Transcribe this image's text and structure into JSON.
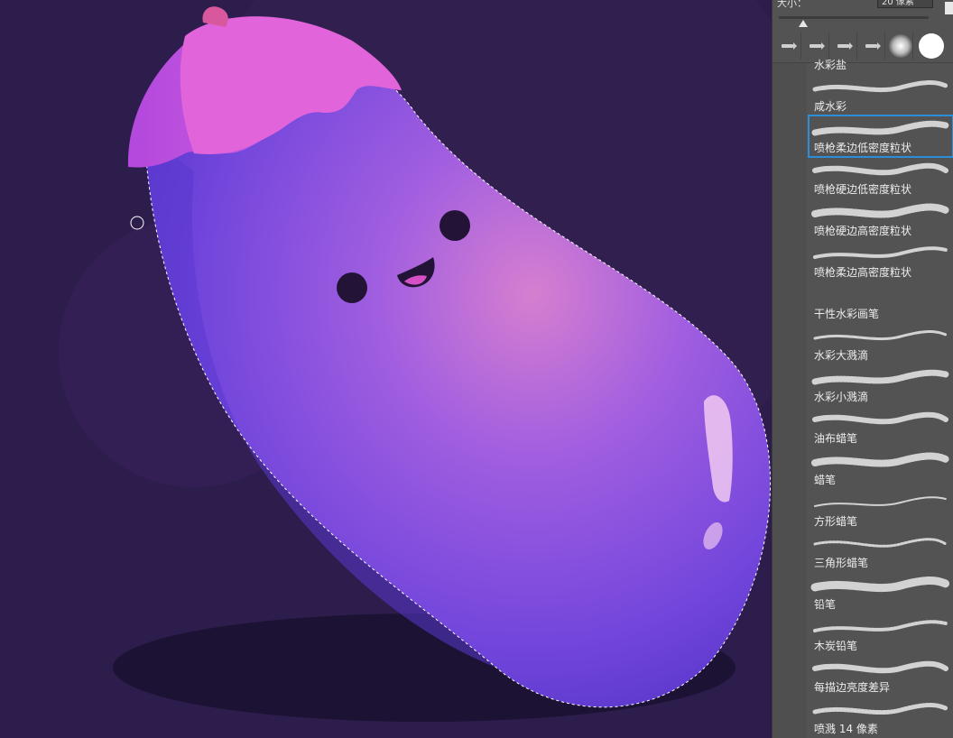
{
  "brush_panel": {
    "size_label": "大小：",
    "size_value": "20 像素",
    "brush_presets": [
      {
        "label": "水彩盐",
        "stroke": "none"
      },
      {
        "label": "咸水彩",
        "stroke": "watercolor-salt-icon"
      },
      {
        "label": "喷枪柔边低密度粒状",
        "stroke": "spray-soft-low-icon",
        "selected": true
      },
      {
        "label": "喷枪硬边低密度粒状",
        "stroke": "spray-hard-low-icon"
      },
      {
        "label": "喷枪硬边高密度粒状",
        "stroke": "spray-hard-high-icon"
      },
      {
        "label": "喷枪柔边高密度粒状",
        "stroke": "spray-soft-high-icon"
      },
      {
        "label": "干性水彩画笔",
        "stroke": "none"
      },
      {
        "label": "水彩大溅滴",
        "stroke": "splatter-large-icon"
      },
      {
        "label": "水彩小溅滴",
        "stroke": "splatter-small-icon"
      },
      {
        "label": "油布蜡笔",
        "stroke": "oil-crayon-icon"
      },
      {
        "label": "蜡笔",
        "stroke": "crayon-icon"
      },
      {
        "label": "方形蜡笔",
        "stroke": "square-crayon-icon"
      },
      {
        "label": "三角形蜡笔",
        "stroke": "triangle-crayon-icon"
      },
      {
        "label": "铅笔",
        "stroke": "pencil-icon"
      },
      {
        "label": "木炭铅笔",
        "stroke": "charcoal-pencil-icon"
      },
      {
        "label": "每描边亮度差异",
        "stroke": "brightness-variation-icon"
      },
      {
        "label": "喷溅 14 像素",
        "stroke": "splatter-14-icon"
      }
    ]
  },
  "colors": {
    "canvas_bg": "#2d1d4c",
    "eggplant_body": "#7b4fe0",
    "eggplant_cap": "#dd5fd6",
    "panel_bg": "#535353",
    "selection_outline": "#2b8ed6"
  }
}
